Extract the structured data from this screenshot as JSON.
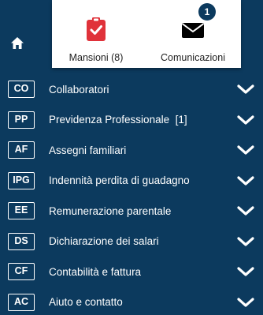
{
  "colors": {
    "background": "#0c3a5e",
    "popup": "#ffffff",
    "tasks_icon": "#e0323a",
    "comms_icon": "#000000",
    "badge": "#0c3a5e"
  },
  "nav": {
    "home_icon": "home-icon"
  },
  "popup": {
    "tasks": {
      "icon": "clipboard-check-icon",
      "label": "Mansioni (8)"
    },
    "comms": {
      "icon": "envelope-icon",
      "label": "Comunicazioni",
      "badge": "1"
    }
  },
  "menu": {
    "items": [
      {
        "code": "CO",
        "label": "Collaboratori"
      },
      {
        "code": "PP",
        "label": "Previdenza Professionale  [1]"
      },
      {
        "code": "AF",
        "label": "Assegni familiari"
      },
      {
        "code": "IPG",
        "label": "Indennità perdita di guadagno"
      },
      {
        "code": "EE",
        "label": "Remunerazione parentale"
      },
      {
        "code": "DS",
        "label": "Dichiarazione dei salari"
      },
      {
        "code": "CF",
        "label": "Contabilità e fattura"
      },
      {
        "code": "AC",
        "label": "Aiuto e contatto"
      }
    ],
    "chevron_icon": "chevron-down-icon"
  }
}
